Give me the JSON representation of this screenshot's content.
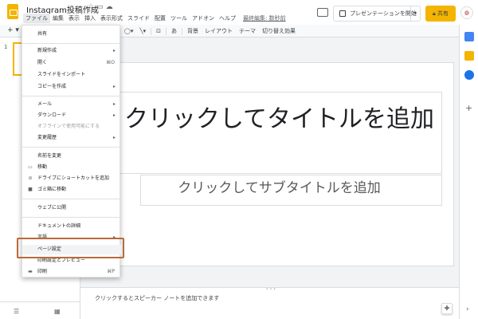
{
  "header": {
    "doc_title": "Instagram投稿作成",
    "menus": [
      "ファイル",
      "編集",
      "表示",
      "挿入",
      "表示形式",
      "スライド",
      "配置",
      "ツール",
      "アドオン",
      "ヘルプ"
    ],
    "last_edit": "最終編集: 数秒前",
    "present_label": "プレゼンテーションを開始",
    "share_label": "共有"
  },
  "toolbar": {
    "new_slide": "+ ▾",
    "text_style": "あ",
    "background": "背景",
    "layout": "レイアウト",
    "theme": "テーマ",
    "transition": "切り替え効果"
  },
  "filmstrip": {
    "slide_number": "1"
  },
  "slide": {
    "title": "クリックしてタイトルを追加",
    "subtitle": "クリックしてサブタイトルを追加"
  },
  "notes": {
    "placeholder": "クリックするとスピーカー ノートを追加できます"
  },
  "file_menu": {
    "items": [
      {
        "label": "共有"
      },
      {
        "label": "新規作成",
        "submenu": true
      },
      {
        "label": "開く",
        "shortcut": "⌘O"
      },
      {
        "label": "スライドをインポート"
      },
      {
        "label": "コピーを作成",
        "submenu": true
      },
      {
        "label": "メール",
        "submenu": true
      },
      {
        "label": "ダウンロード",
        "submenu": true
      },
      {
        "label": "オフラインで使用可能にする"
      },
      {
        "label": "変更履歴",
        "submenu": true
      },
      {
        "label": "名前を変更"
      },
      {
        "label": "移動",
        "icon": "folder-icon"
      },
      {
        "label": "ドライブにショートカットを追加",
        "icon": "drive-shortcut-icon"
      },
      {
        "label": "ゴミ箱に移動",
        "icon": "trash-icon"
      },
      {
        "label": "ウェブに公開"
      },
      {
        "label": "ドキュメントの詳細"
      },
      {
        "label": "言語",
        "submenu": true
      },
      {
        "label": "ページ設定"
      },
      {
        "label": "印刷設定とプレビュー"
      },
      {
        "label": "印刷",
        "shortcut": "⌘P",
        "icon": "printer-icon"
      }
    ]
  },
  "colors": {
    "accent": "#f4b400",
    "highlight_border": "#b86a3c"
  }
}
